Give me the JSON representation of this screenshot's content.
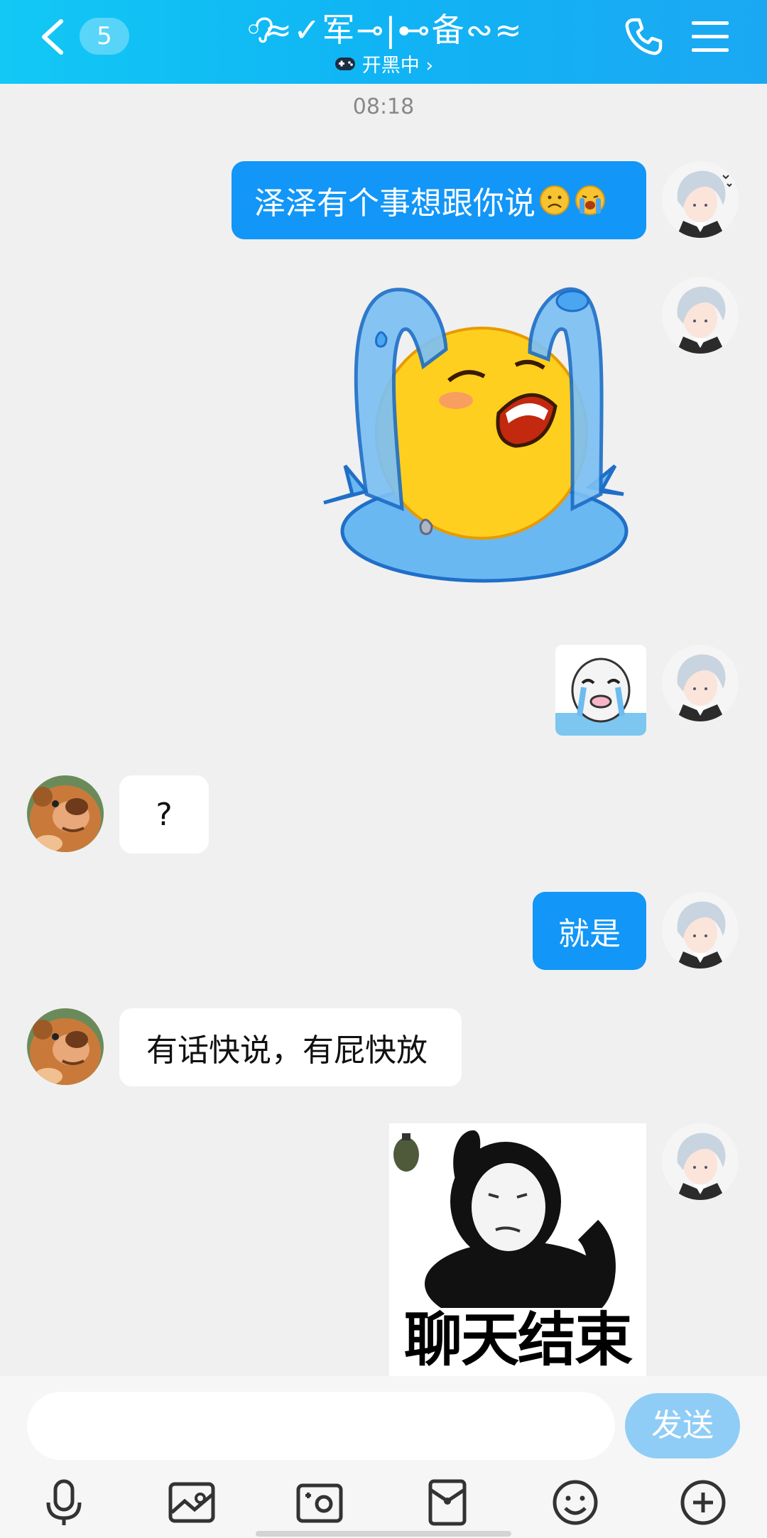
{
  "header": {
    "unread_count": "5",
    "title": "◦≈✓军⊸|⊷备∾≈",
    "subtitle": "开黑中 ›"
  },
  "chat": {
    "timestamp": "08:18",
    "messages": [
      {
        "from": "me",
        "type": "text",
        "text": "泽泽有个事想跟你说"
      },
      {
        "from": "me",
        "type": "sticker",
        "sticker": "crying-emoji-sticker"
      },
      {
        "from": "me",
        "type": "sticker",
        "sticker": "crying-face-meme-sticker"
      },
      {
        "from": "friend",
        "type": "text",
        "text": "?"
      },
      {
        "from": "me",
        "type": "text",
        "text": "就是"
      },
      {
        "from": "friend",
        "type": "text",
        "text": "有话快说，有屁快放"
      },
      {
        "from": "me",
        "type": "sticker",
        "sticker": "panda-grenade-meme-sticker",
        "caption": "聊天结束"
      }
    ]
  },
  "input": {
    "placeholder": "",
    "send_label": "发送"
  },
  "toolbar": [
    "mic-icon",
    "photo-icon",
    "camera-icon",
    "red-packet-icon",
    "emoji-icon",
    "plus-icon"
  ],
  "colors": {
    "header": "#10b4f4",
    "outgoing_bubble": "#1296f7",
    "incoming_bubble": "#ffffff",
    "send_button": "#8fcdf6",
    "background": "#f0f0f0"
  }
}
